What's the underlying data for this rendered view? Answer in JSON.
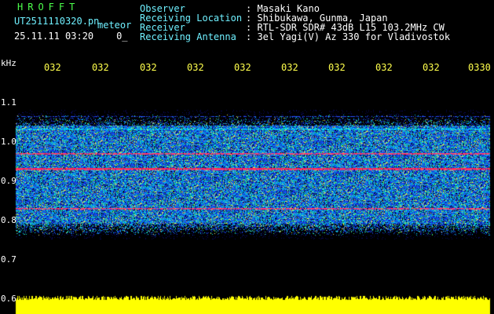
{
  "app_title": "HROFFT",
  "file_name": "UT2511110320.pn",
  "meteor_label": "meteor",
  "date_time": "25.11.11 03:20",
  "count_value": "0_",
  "info": [
    {
      "label": "Observer",
      "value": ": Masaki Kano"
    },
    {
      "label": "Receiving Location",
      "value": ": Shibukawa, Gunma, Japan"
    },
    {
      "label": "Receiver",
      "value": ": RTL-SDR SDR# 43dB L15 103.2MHz CW"
    },
    {
      "label": "Receiving Antenna",
      "value": ": 3el Yagi(V) Az 330 for Vladivostok"
    }
  ],
  "freq_unit": "kHz",
  "freq_ticks": [
    "1.1",
    "1.0",
    "0.9",
    "0.8",
    "0.7",
    "0.6"
  ],
  "time_ticks": [
    "032",
    "032",
    "032",
    "032",
    "032",
    "032",
    "032",
    "032",
    "032",
    "0330"
  ],
  "colors": {
    "background": "#000000",
    "title": "#4cff4c",
    "labels": "#6ff0ff",
    "time_ticks": "#ffff4c",
    "noise_blue": "#1a3cff",
    "noise_cyan": "#00e5ff",
    "carrier_red": "#ff2a5a",
    "baseline_yellow": "#ffff00"
  }
}
